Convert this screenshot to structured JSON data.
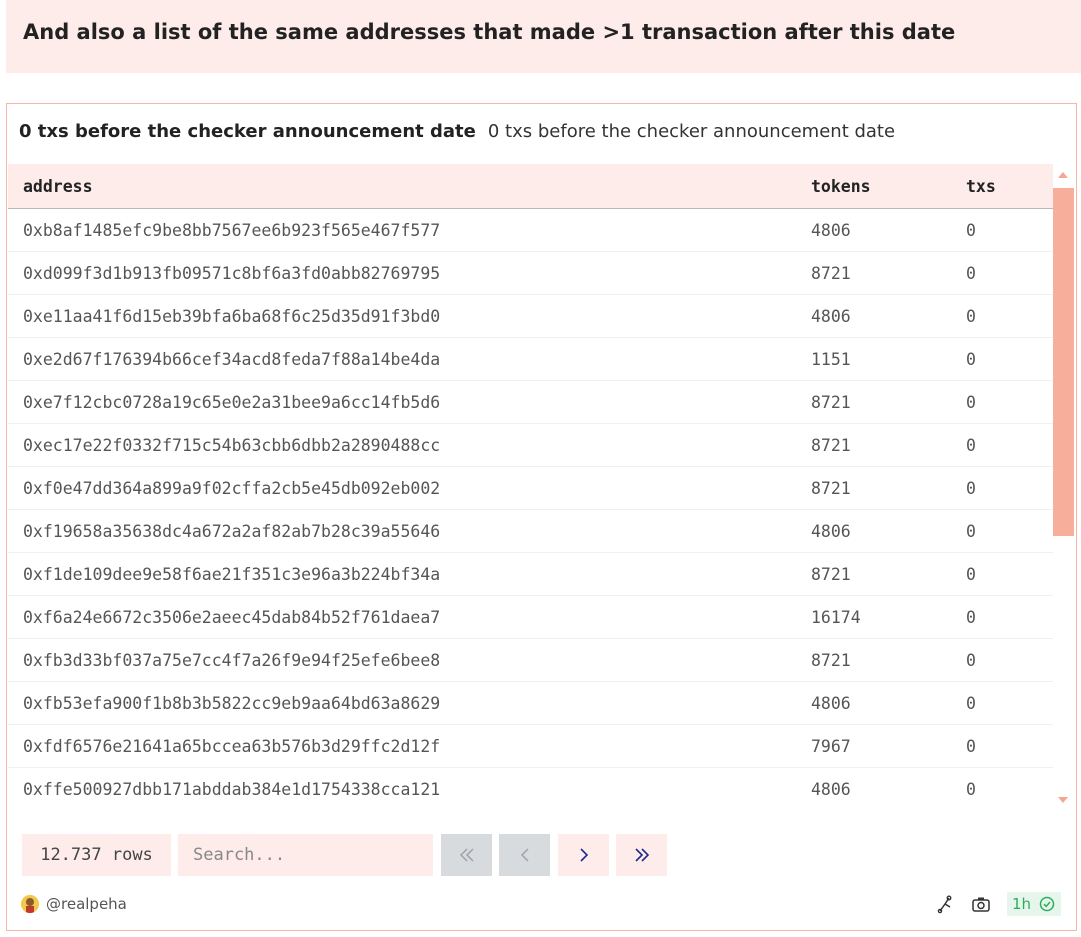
{
  "text_widget": {
    "heading": "And also a list of the same addresses that made >1 transaction after this date"
  },
  "table_widget": {
    "title": "0 txs before the checker announcement date",
    "subtitle": "0 txs before the checker announcement date",
    "columns": [
      "address",
      "tokens",
      "txs"
    ],
    "rows": [
      {
        "address": "0xb8af1485efc9be8bb7567ee6b923f565e467f577",
        "tokens": "4806",
        "txs": "0"
      },
      {
        "address": "0xd099f3d1b913fb09571c8bf6a3fd0abb82769795",
        "tokens": "8721",
        "txs": "0"
      },
      {
        "address": "0xe11aa41f6d15eb39bfa6ba68f6c25d35d91f3bd0",
        "tokens": "4806",
        "txs": "0"
      },
      {
        "address": "0xe2d67f176394b66cef34acd8feda7f88a14be4da",
        "tokens": "1151",
        "txs": "0"
      },
      {
        "address": "0xe7f12cbc0728a19c65e0e2a31bee9a6cc14fb5d6",
        "tokens": "8721",
        "txs": "0"
      },
      {
        "address": "0xec17e22f0332f715c54b63cbb6dbb2a2890488cc",
        "tokens": "8721",
        "txs": "0"
      },
      {
        "address": "0xf0e47dd364a899a9f02cffa2cb5e45db092eb002",
        "tokens": "8721",
        "txs": "0"
      },
      {
        "address": "0xf19658a35638dc4a672a2af82ab7b28c39a55646",
        "tokens": "4806",
        "txs": "0"
      },
      {
        "address": "0xf1de109dee9e58f6ae21f351c3e96a3b224bf34a",
        "tokens": "8721",
        "txs": "0"
      },
      {
        "address": "0xf6a24e6672c3506e2aeec45dab84b52f761daea7",
        "tokens": "16174",
        "txs": "0"
      },
      {
        "address": "0xfb3d33bf037a75e7cc4f7a26f9e94f25efe6bee8",
        "tokens": "8721",
        "txs": "0"
      },
      {
        "address": "0xfb53efa900f1b8b3b5822cc9eb9aa64bd63a8629",
        "tokens": "4806",
        "txs": "0"
      },
      {
        "address": "0xfdf6576e21641a65bccea63b576b3d29ffc2d12f",
        "tokens": "7967",
        "txs": "0"
      },
      {
        "address": "0xffe500927dbb171abddab384e1d1754338cca121",
        "tokens": "4806",
        "txs": "0"
      }
    ],
    "scroll_position": 1.0,
    "footer": {
      "rows_count": "12.737 rows",
      "search_placeholder": "Search...",
      "pager": {
        "first": {
          "icon": "double-chevron-left-icon",
          "enabled": false
        },
        "prev": {
          "icon": "chevron-left-icon",
          "enabled": false
        },
        "next": {
          "icon": "chevron-right-icon",
          "enabled": true
        },
        "last": {
          "icon": "double-chevron-right-icon",
          "enabled": true
        }
      }
    },
    "bottom": {
      "author": "@realpeha",
      "refresh_label": "1h",
      "icons": [
        "fork-icon",
        "camera-icon",
        "check-circle-icon"
      ]
    }
  },
  "colors": {
    "accent_bg": "#fdecea",
    "border": "#f3b8a8",
    "scroll_thumb": "#f7ae9a",
    "pager_arrow": "#1f2b8f",
    "pager_disabled_bg": "#d8dbde",
    "success": "#2eae5c"
  }
}
